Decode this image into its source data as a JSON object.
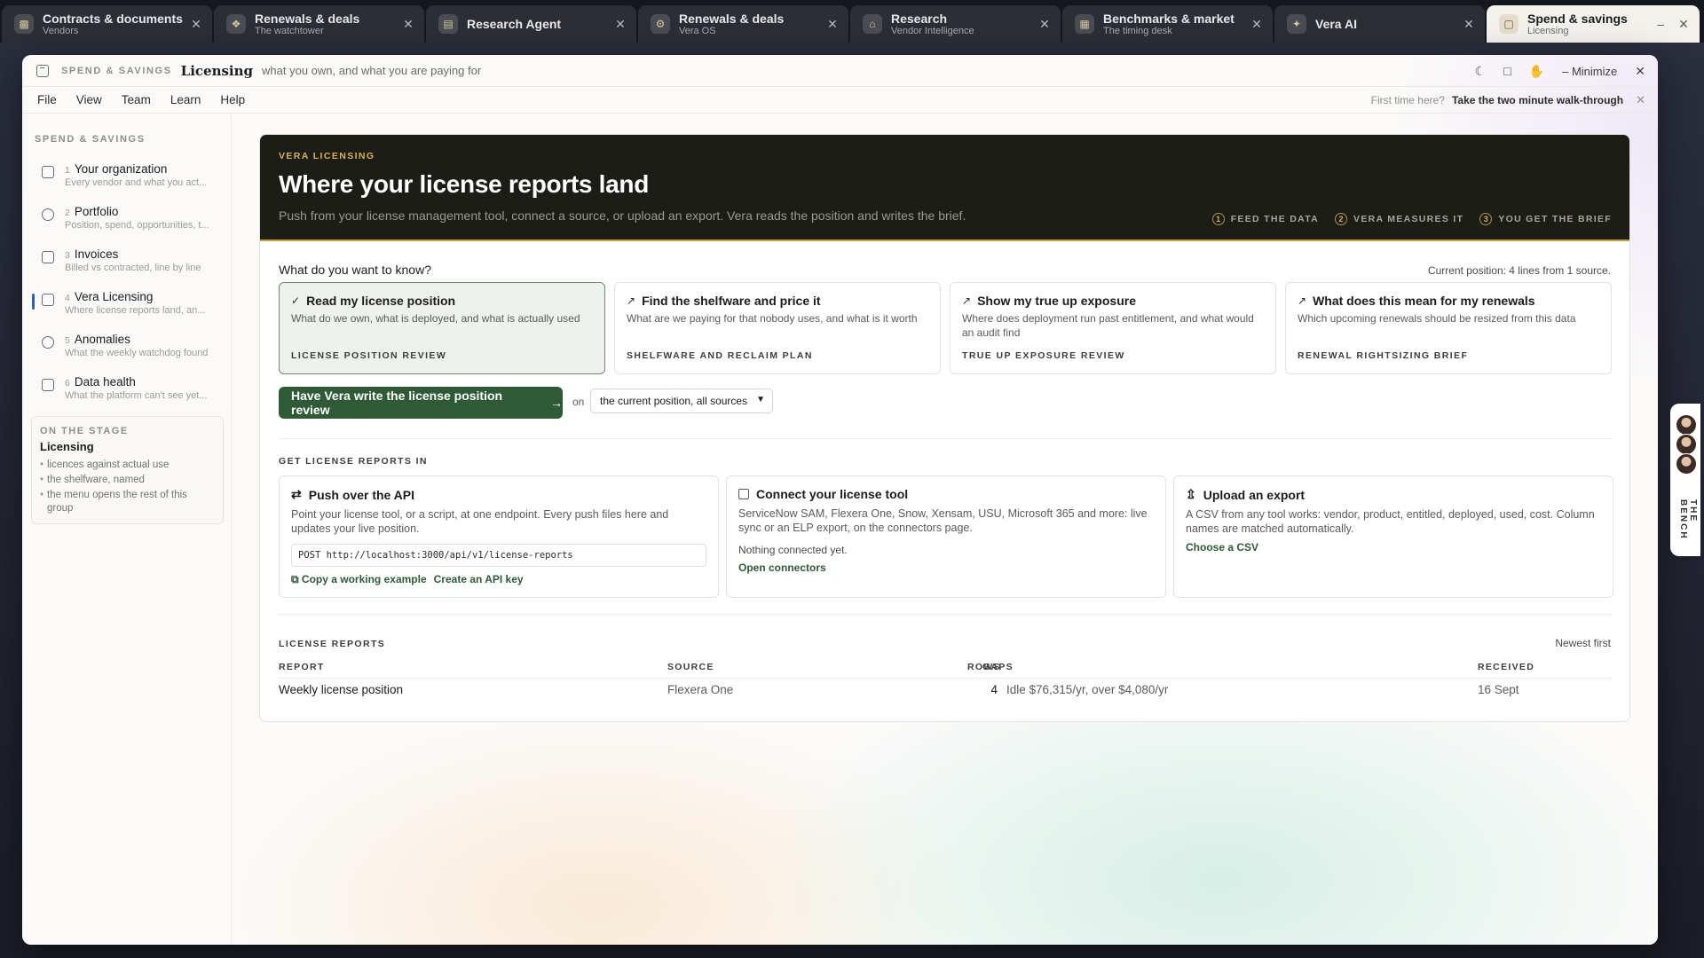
{
  "tabs": [
    {
      "title": "Contracts & documents",
      "subtitle": "Vendors",
      "icon": "briefcase-icon"
    },
    {
      "title": "Renewals & deals",
      "subtitle": "The watchtower",
      "icon": "handshake-icon"
    },
    {
      "title": "Research Agent",
      "subtitle": "",
      "icon": "document-icon"
    },
    {
      "title": "Renewals & deals",
      "subtitle": "Vera OS",
      "icon": "gear-icon"
    },
    {
      "title": "Research",
      "subtitle": "Vendor Intelligence",
      "icon": "bank-icon"
    },
    {
      "title": "Benchmarks & market",
      "subtitle": "The timing desk",
      "icon": "calendar-icon"
    },
    {
      "title": "Vera AI",
      "subtitle": "",
      "icon": "sparkle-icon"
    },
    {
      "title": "Spend & savings",
      "subtitle": "Licensing",
      "icon": "file-icon"
    }
  ],
  "window": {
    "kicker": "SPEND & SAVINGS",
    "title": "Licensing",
    "subtitle": "what you own, and what you are paying for",
    "minimize_label": "Minimize"
  },
  "menu": [
    "File",
    "View",
    "Team",
    "Learn",
    "Help"
  ],
  "walkthrough": {
    "lead": "First time here?",
    "link": "Take the two minute walk-through"
  },
  "sidebar": {
    "heading": "SPEND & SAVINGS",
    "items": [
      {
        "num": "1",
        "title": "Your organization",
        "subtitle": "Every vendor and what you act...",
        "icon": "building-icon"
      },
      {
        "num": "2",
        "title": "Portfolio",
        "subtitle": "Position, spend, opportunities, t...",
        "icon": "pie-icon"
      },
      {
        "num": "3",
        "title": "Invoices",
        "subtitle": "Billed vs contracted, line by line",
        "icon": "receipt-icon"
      },
      {
        "num": "4",
        "title": "Vera Licensing",
        "subtitle": "Where license reports land, an...",
        "icon": "file-icon"
      },
      {
        "num": "5",
        "title": "Anomalies",
        "subtitle": "What the weekly watchdog found",
        "icon": "shield-icon"
      },
      {
        "num": "6",
        "title": "Data health",
        "subtitle": "What the platform can't see yet...",
        "icon": "database-icon"
      }
    ],
    "stage": {
      "kicker": "ON THE STAGE",
      "title": "Licensing",
      "bullets": [
        "licences against actual use",
        "the shelfware, named",
        "the menu opens the rest of this group"
      ]
    }
  },
  "hero": {
    "kicker": "VERA LICENSING",
    "title": "Where your license reports land",
    "subtitle": "Push from your license management tool, connect a source, or upload an export. Vera reads the position and writes the brief.",
    "steps": [
      "FEED THE DATA",
      "VERA MEASURES IT",
      "YOU GET THE BRIEF"
    ]
  },
  "question": "What do you want to know?",
  "current_position": "Current position: 4 lines from 1 source.",
  "cards": [
    {
      "title": "Read my license position",
      "desc": "What do we own, what is deployed, and what is actually used",
      "kicker": "LICENSE POSITION REVIEW"
    },
    {
      "title": "Find the shelfware and price it",
      "desc": "What are we paying for that nobody uses, and what is it worth",
      "kicker": "SHELFWARE AND RECLAIM PLAN"
    },
    {
      "title": "Show my true up exposure",
      "desc": "Where does deployment run past entitlement, and what would an audit find",
      "kicker": "TRUE UP EXPOSURE REVIEW"
    },
    {
      "title": "What does this mean for my renewals",
      "desc": "Which upcoming renewals should be resized from this data",
      "kicker": "RENEWAL RIGHTSIZING BRIEF"
    }
  ],
  "cta": {
    "label": "Have Vera write the license position review",
    "on": "on",
    "scope": "the current position, all sources"
  },
  "ingest": {
    "heading": "GET LICENSE REPORTS IN",
    "api": {
      "title": "Push over the API",
      "desc": "Point your license tool, or a script, at one endpoint. Every push files here and updates your live position.",
      "endpoint": "POST http://localhost:3000/api/v1/license-reports",
      "copy": "Copy a working example",
      "key": "Create an API key"
    },
    "connect": {
      "title": "Connect your license tool",
      "desc": "ServiceNow SAM, Flexera One, Snow, Xensam, USU, Microsoft 365 and more: live sync or an ELP export, on the connectors page.",
      "note": "Nothing connected yet.",
      "link": "Open connectors"
    },
    "upload": {
      "title": "Upload an export",
      "desc": "A CSV from any tool works: vendor, product, entitled, deployed, used, cost. Column names are matched automatically.",
      "link": "Choose a CSV"
    }
  },
  "reports": {
    "heading": "LICENSE REPORTS",
    "sort": "Newest first",
    "columns": [
      "REPORT",
      "SOURCE",
      "ROWS",
      "GAPS",
      "RECEIVED"
    ],
    "rows": [
      {
        "report": "Weekly license position",
        "source": "Flexera One",
        "rows": "4",
        "gaps": "Idle $76,315/yr, over $4,080/yr",
        "received": "16 Sept"
      }
    ]
  },
  "bench": {
    "label": "THE BENCH"
  }
}
